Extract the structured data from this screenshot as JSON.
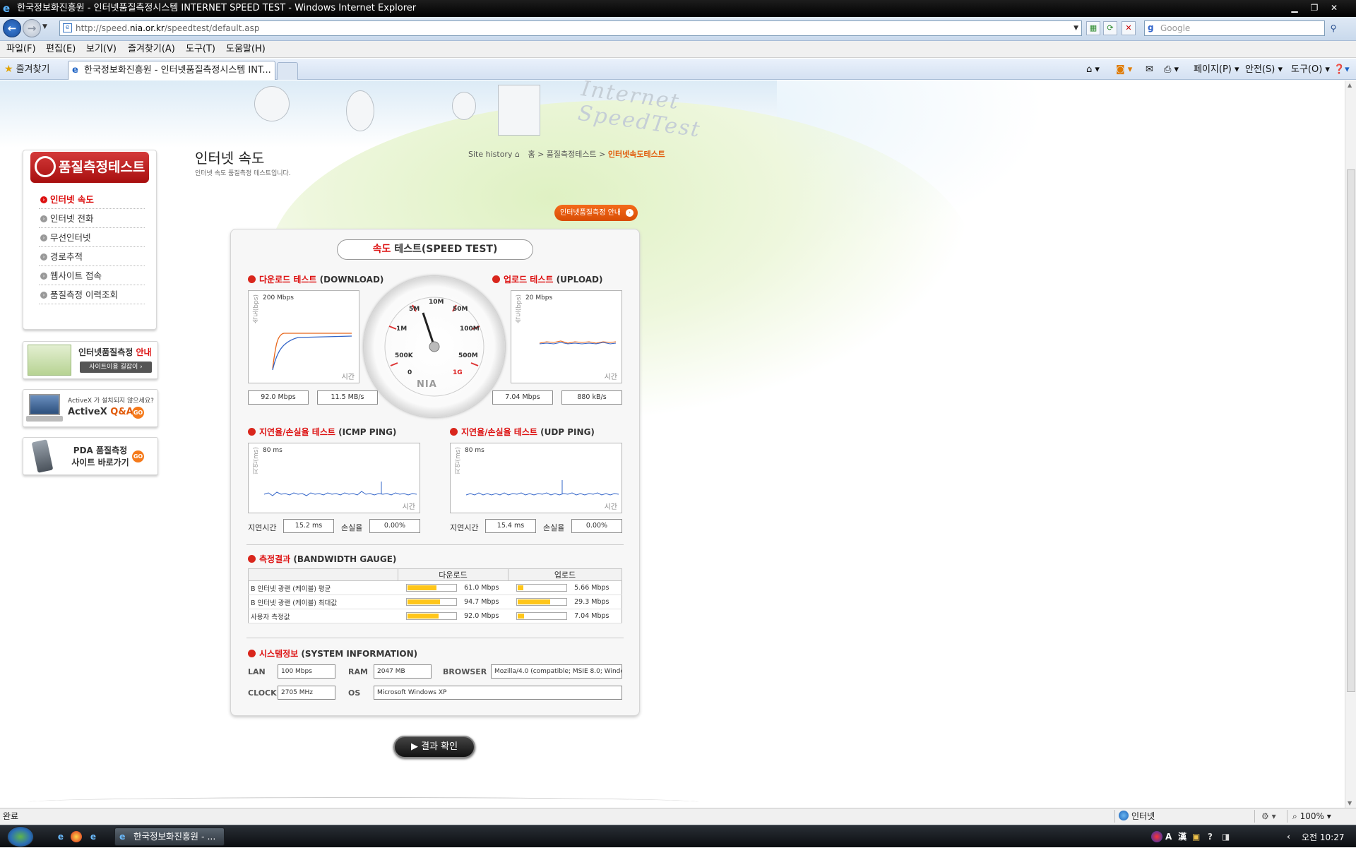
{
  "window": {
    "title": "한국정보화진흥원 - 인터넷품질측정시스템 INTERNET SPEED TEST - Windows Internet Explorer",
    "url_prefix": "http://speed.",
    "url_domain": "nia.or.kr",
    "url_suffix": "/speedtest/default.asp",
    "search_placeholder": "Google"
  },
  "menu": [
    "파일(F)",
    "편집(E)",
    "보기(V)",
    "즐겨찾기(A)",
    "도구(T)",
    "도움말(H)"
  ],
  "favorites_label": "즐겨찾기",
  "tab_title": "한국정보화진흥원 - 인터넷품질측정시스템 INT...",
  "command_bar": {
    "page": "페이지(P)",
    "safety": "안전(S)",
    "tools": "도구(O)"
  },
  "page": {
    "title": "인터넷 속도",
    "subtitle": "인터넷 속도 품질측정 테스트입니다.",
    "breadcrumb": {
      "site_history": "Site history",
      "home": "홈",
      "sep1": ">",
      "section": "품질측정테스트",
      "sep2": ">",
      "current": "인터넷속도테스트"
    },
    "guide_button": "인터넷품질측정 안내"
  },
  "left_nav": {
    "heading": "품질측정테스트",
    "items": [
      {
        "label": "인터넷 속도",
        "active": true
      },
      {
        "label": "인터넷 전화"
      },
      {
        "label": "무선인터넷"
      },
      {
        "label": "경로추적"
      },
      {
        "label": "웹사이트 접속"
      },
      {
        "label": "품질측정 이력조회"
      }
    ],
    "promo1": {
      "title_a": "인터넷품질측정 ",
      "title_b": "안내",
      "button": "사이트이용 길잡이"
    },
    "promo2": {
      "line1": "ActiveX 가 설치되지 않으세요?",
      "line2a": "ActiveX ",
      "line2b": "Q&A",
      "go": "GO"
    },
    "promo3": {
      "line1": "PDA 품질측정",
      "line2": "사이트 바로가기",
      "go": "GO"
    }
  },
  "speed_test": {
    "title_red": "속도",
    "title_rest": " 테스트(SPEED TEST)",
    "download": {
      "title_red": "다운로드 테스트",
      "title_rest": " (DOWNLOAD)",
      "scale": "200 Mbps",
      "y_label": "속도(bps)",
      "x_label": "시간",
      "speed": "92.0 Mbps",
      "rate": "11.5 MB/s"
    },
    "upload": {
      "title_red": "업로드 테스트",
      "title_rest": " (UPLOAD)",
      "scale": "20 Mbps",
      "y_label": "속도(bps)",
      "x_label": "시간",
      "speed": "7.04 Mbps",
      "rate": "880 kB/s"
    },
    "gauge": {
      "labels": [
        "0",
        "500K",
        "1M",
        "5M",
        "10M",
        "50M",
        "100M",
        "500M",
        "1G"
      ],
      "brand": "NIA"
    }
  },
  "ping": {
    "icmp": {
      "title_red": "지연율/손실율 테스트",
      "title_rest": " (ICMP PING)",
      "scale": "80 ms",
      "y_label": "지연(ms)",
      "x_label": "시간",
      "latency_label": "지연시간",
      "latency": "15.2 ms",
      "loss_label": "손실율",
      "loss": "0.00%"
    },
    "udp": {
      "title_red": "지연율/손실율 테스트",
      "title_rest": " (UDP PING)",
      "scale": "80 ms",
      "y_label": "지연(ms)",
      "x_label": "시간",
      "latency_label": "지연시간",
      "latency": "15.4 ms",
      "loss_label": "손실율",
      "loss": "0.00%"
    }
  },
  "bandwidth": {
    "title_red": "측정결과",
    "title_rest": " (BANDWIDTH GAUGE)",
    "col_download": "다운로드",
    "col_upload": "업로드",
    "rows": [
      {
        "label": "B 인터넷 광랜 (케이블) 평균",
        "down": "61.0 Mbps",
        "down_frac": 0.61,
        "up": "5.66 Mbps",
        "up_frac": 0.12
      },
      {
        "label": "B 인터넷 광랜 (케이블) 최대값",
        "down": "94.7 Mbps",
        "down_frac": 0.68,
        "up": "29.3 Mbps",
        "up_frac": 0.68
      },
      {
        "label": "사용자 측정값",
        "down": "92.0 Mbps",
        "down_frac": 0.66,
        "up": "7.04 Mbps",
        "up_frac": 0.14
      }
    ]
  },
  "system_info": {
    "title_red": "시스템정보",
    "title_rest": " (SYSTEM INFORMATION)",
    "lan_label": "LAN",
    "lan": "100 Mbps",
    "ram_label": "RAM",
    "ram": "2047 MB",
    "browser_label": "BROWSER",
    "browser": "Mozilla/4.0 (compatible; MSIE 8.0; Windo",
    "clock_label": "CLOCK",
    "clock": "2705 MHz",
    "os_label": "OS",
    "os": "Microsoft Windows XP"
  },
  "result_button": "▶ 결과 확인",
  "status": {
    "left": "완료",
    "zone": "인터넷",
    "zoom": "100%"
  },
  "taskbar": {
    "task": "한국정보화진흥원 - ...",
    "clock": "오전 10:27",
    "ime_a": "A",
    "ime_b": "漢"
  },
  "colors": {
    "accent_red": "#d11111",
    "orange": "#f46a1c",
    "bar_yellow": "#ffc61a"
  }
}
